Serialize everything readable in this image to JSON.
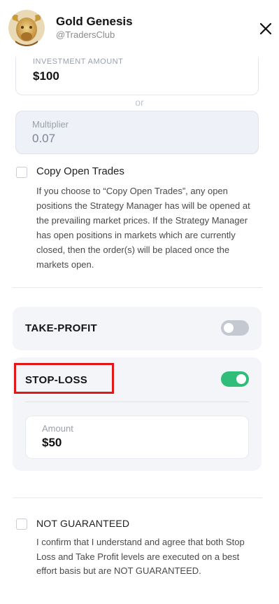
{
  "header": {
    "title": "Gold Genesis",
    "handle": "@TradersClub",
    "avatar_icon": "golden-bull-avatar",
    "close_icon": "close-icon"
  },
  "investment": {
    "label": "INVESTMENT AMOUNT",
    "value": "$100"
  },
  "or_text": "or",
  "multiplier": {
    "label": "Multiplier",
    "value": "0.07"
  },
  "copy_open_trades": {
    "title": "Copy Open Trades",
    "description": "If you choose to “Copy Open Trades”, any open positions the Strategy Manager has will be opened at the prevailing market prices. If the Strategy Manager has open positions in markets which are currently closed, then the order(s) will be placed once the markets open.",
    "checked": false
  },
  "take_profit": {
    "title": "TAKE-PROFIT",
    "enabled": false
  },
  "stop_loss": {
    "title": "STOP-LOSS",
    "enabled": true,
    "amount_label": "Amount",
    "amount_value": "$50"
  },
  "not_guaranteed": {
    "title": "NOT GUARANTEED",
    "description": "I confirm that I understand and agree that both Stop Loss and Take Profit levels are executed on a best effort basis but are NOT GUARANTEED.",
    "checked": false
  },
  "colors": {
    "toggle_on": "#2fbd7a",
    "toggle_off": "#c3c8d1",
    "highlight_box": "#e21818",
    "panel_bg": "#f3f5f9"
  }
}
